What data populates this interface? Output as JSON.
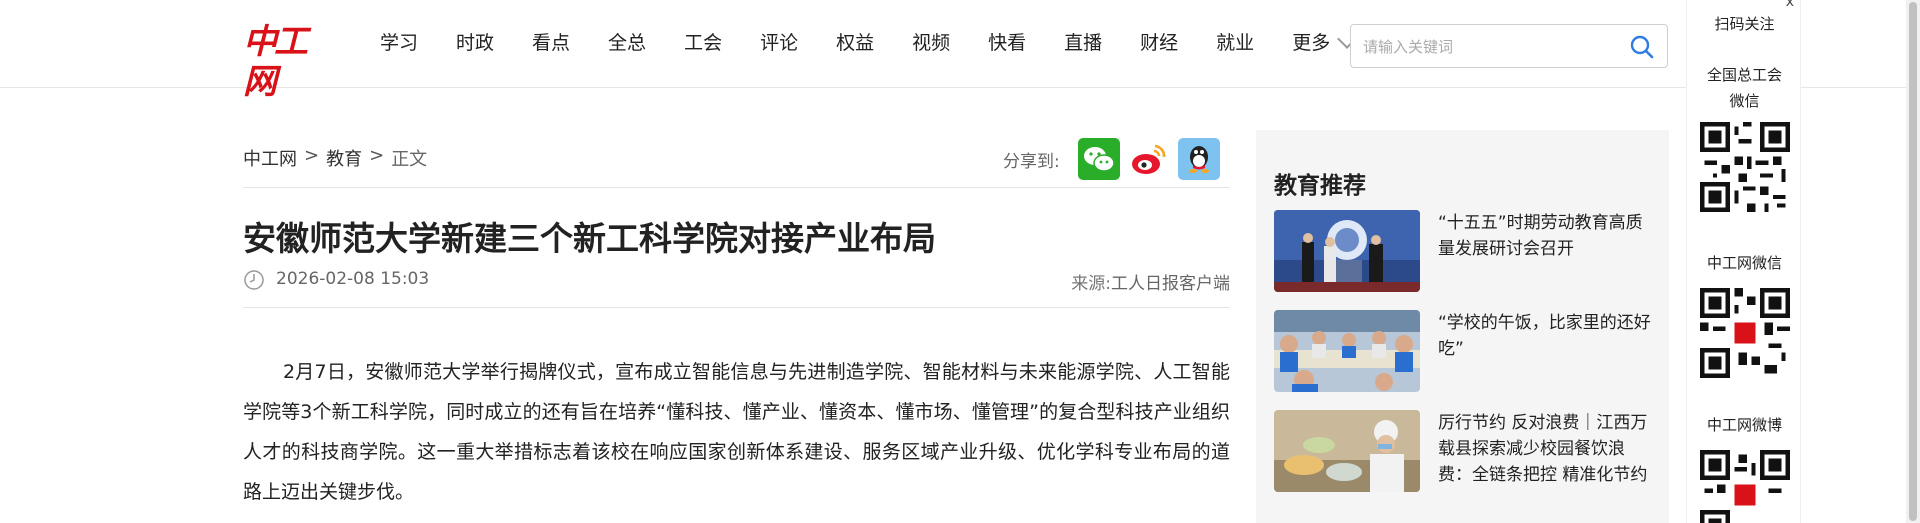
{
  "header": {
    "logo_text": "中工网",
    "nav": [
      "学习",
      "时政",
      "看点",
      "全总",
      "工会",
      "评论",
      "权益",
      "视频",
      "快看",
      "直播",
      "财经",
      "就业"
    ],
    "nav_more": "更多",
    "search_placeholder": "请输入关键词"
  },
  "breadcrumb": {
    "home": "中工网",
    "sep": ">",
    "section": "教育",
    "current": "正文"
  },
  "share": {
    "label": "分享到:"
  },
  "article": {
    "title": "安徽师范大学新建三个新工科学院对接产业布局",
    "date": "2026-02-08 15:03",
    "source_label": "来源:",
    "source": "工人日报客户端",
    "paragraph": "2月7日，安徽师范大学举行揭牌仪式，宣布成立智能信息与先进制造学院、智能材料与未来能源学院、人工智能学院等3个新工科学院，同时成立的还有旨在培养“懂科技、懂产业、懂资本、懂市场、懂管理”的复合型科技产业组织人才的科技商学院。这一重大举措标志着该校在响应国家创新体系建设、服务区域产业升级、优化学科专业布局的道路上迈出关键步伐。"
  },
  "recommend": {
    "title": "教育推荐",
    "items": [
      {
        "text": "“十五五”时期劳动教育高质量发展研讨会召开"
      },
      {
        "text": "“学校的午饭，比家里的还好吃”"
      },
      {
        "text": "厉行节约 反对浪费｜江西万载县探索减少校园餐饮浪费：全链条把控 精准化节约"
      }
    ]
  },
  "sidebar": {
    "close": "x",
    "head": "扫码关注",
    "label1": "全国总工会微信",
    "label2": "中工网微信",
    "label3": "中工网微博"
  },
  "colors": {
    "brand": "#d9121a",
    "search_icon": "#2f7de1",
    "wechat": "#2aae2a",
    "qq_bg": "#7ec3ef"
  }
}
